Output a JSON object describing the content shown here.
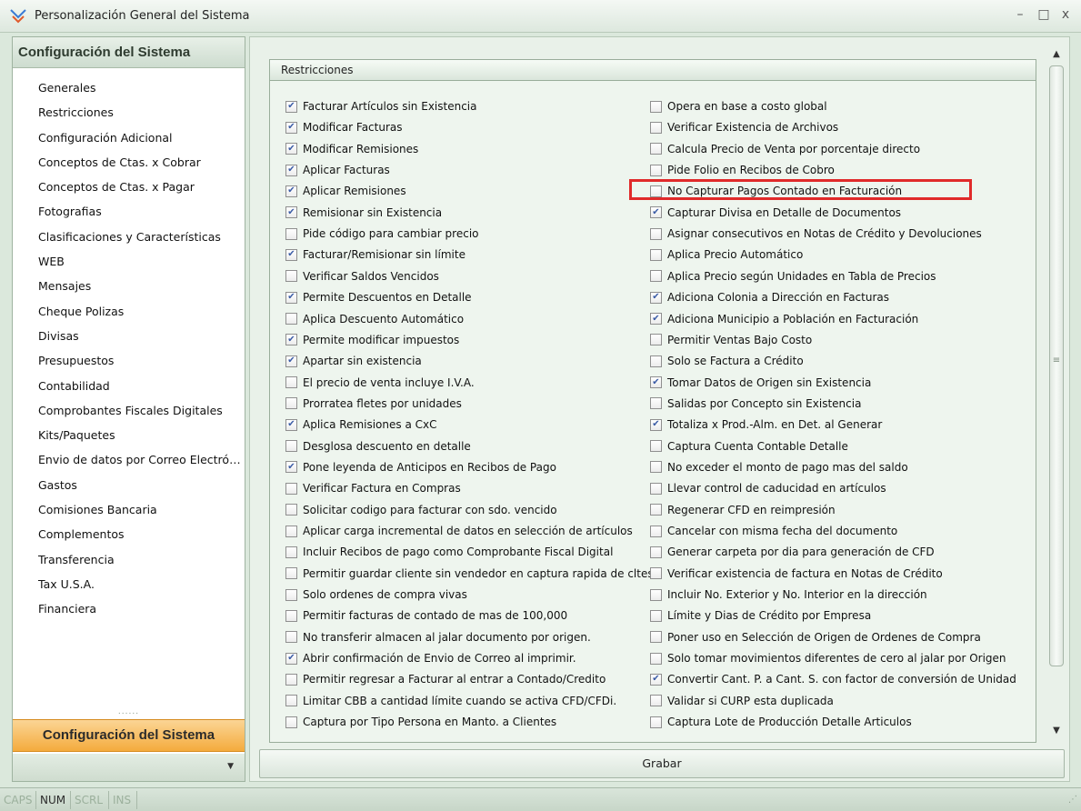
{
  "window": {
    "title": "Personalización General del Sistema",
    "minimize": "–",
    "maximize": "□",
    "close": "x"
  },
  "sidebar": {
    "header": "Configuración del Sistema",
    "items": [
      "Generales",
      "Restricciones",
      "Configuración Adicional",
      "Conceptos de Ctas. x Cobrar",
      "Conceptos de Ctas. x Pagar",
      "Fotografias",
      "Clasificaciones y Características",
      "WEB",
      "Mensajes",
      "Cheque Polizas",
      "Divisas",
      "Presupuestos",
      "Contabilidad",
      "Comprobantes Fiscales Digitales",
      "Kits/Paquetes",
      "Envio de datos por Correo Electrónico",
      "Gastos",
      "Comisiones Bancaria",
      "Complementos",
      "Transferencia",
      "Tax U.S.A.",
      "Financiera"
    ],
    "active_section": "Configuración del Sistema"
  },
  "panel": {
    "title": "Restricciones",
    "left_options": [
      {
        "label": "Facturar Artículos sin Existencia",
        "checked": true
      },
      {
        "label": "Modificar Facturas",
        "checked": true
      },
      {
        "label": "Modificar Remisiones",
        "checked": true
      },
      {
        "label": "Aplicar Facturas",
        "checked": true
      },
      {
        "label": "Aplicar Remisiones",
        "checked": true
      },
      {
        "label": "Remisionar sin Existencia",
        "checked": true
      },
      {
        "label": "Pide código para cambiar precio",
        "checked": false
      },
      {
        "label": "Facturar/Remisionar sin límite",
        "checked": true
      },
      {
        "label": "Verificar Saldos Vencidos",
        "checked": false
      },
      {
        "label": "Permite Descuentos en Detalle",
        "checked": true
      },
      {
        "label": "Aplica Descuento Automático",
        "checked": false
      },
      {
        "label": "Permite modificar impuestos",
        "checked": true
      },
      {
        "label": "Apartar sin existencia",
        "checked": true
      },
      {
        "label": "El precio de venta incluye I.V.A.",
        "checked": false
      },
      {
        "label": "Prorratea fletes por unidades",
        "checked": false
      },
      {
        "label": "Aplica Remisiones a CxC",
        "checked": true
      },
      {
        "label": "Desglosa descuento en detalle",
        "checked": false
      },
      {
        "label": "Pone leyenda de Anticipos en Recibos de Pago",
        "checked": true
      },
      {
        "label": "Verificar Factura en Compras",
        "checked": false
      },
      {
        "label": "Solicitar codigo para facturar con sdo. vencido",
        "checked": false
      },
      {
        "label": "Aplicar carga incremental de datos en selección de artículos",
        "checked": false
      },
      {
        "label": "Incluir Recibos de pago como Comprobante Fiscal Digital",
        "checked": false
      },
      {
        "label": "Permitir guardar cliente sin vendedor en captura rapida de cltes.",
        "checked": false
      },
      {
        "label": "Solo ordenes de compra vivas",
        "checked": false
      },
      {
        "label": "Permitir facturas de contado de mas de 100,000",
        "checked": false
      },
      {
        "label": "No transferir almacen al jalar documento por origen.",
        "checked": false
      },
      {
        "label": "Abrir confirmación de Envio de Correo al imprimir.",
        "checked": true
      },
      {
        "label": "Permitir regresar a Facturar al entrar a Contado/Credito",
        "checked": false
      },
      {
        "label": "Limitar CBB a cantidad límite cuando se activa CFD/CFDi.",
        "checked": false
      },
      {
        "label": "Captura por Tipo Persona en Manto. a Clientes",
        "checked": false
      }
    ],
    "right_options": [
      {
        "label": "Opera en base a costo global",
        "checked": false
      },
      {
        "label": "Verificar Existencia de Archivos",
        "checked": false
      },
      {
        "label": "Calcula Precio de Venta por porcentaje directo",
        "checked": false
      },
      {
        "label": "Pide Folio en Recibos de Cobro",
        "checked": false
      },
      {
        "label": "No Capturar Pagos Contado en Facturación",
        "checked": false
      },
      {
        "label": "Capturar Divisa en Detalle de Documentos",
        "checked": true
      },
      {
        "label": "Asignar consecutivos en Notas de Crédito y Devoluciones",
        "checked": false
      },
      {
        "label": "Aplica Precio Automático",
        "checked": false
      },
      {
        "label": "Aplica Precio según Unidades en Tabla de Precios",
        "checked": false
      },
      {
        "label": "Adiciona Colonia a Dirección en Facturas",
        "checked": true
      },
      {
        "label": "Adiciona Municipio a Población en Facturación",
        "checked": true
      },
      {
        "label": "Permitir Ventas Bajo Costo",
        "checked": false
      },
      {
        "label": "Solo se Factura a Crédito",
        "checked": false
      },
      {
        "label": "Tomar Datos de Origen sin Existencia",
        "checked": true
      },
      {
        "label": "Salidas por Concepto sin Existencia",
        "checked": false
      },
      {
        "label": "Totaliza x Prod.-Alm. en Det. al Generar",
        "checked": true
      },
      {
        "label": "Captura Cuenta Contable Detalle",
        "checked": false
      },
      {
        "label": "No exceder el monto de pago mas del saldo",
        "checked": false
      },
      {
        "label": "Llevar control de caducidad en artículos",
        "checked": false
      },
      {
        "label": "Regenerar CFD en reimpresión",
        "checked": false
      },
      {
        "label": "Cancelar con misma fecha del documento",
        "checked": false
      },
      {
        "label": "Generar carpeta por dia para generación de CFD",
        "checked": false
      },
      {
        "label": "Verificar existencia de factura en Notas de Crédito",
        "checked": false
      },
      {
        "label": "Incluir No. Exterior y No. Interior en la dirección",
        "checked": false
      },
      {
        "label": "Límite y Dias de Crédito por Empresa",
        "checked": false
      },
      {
        "label": "Poner uso en Selección de Origen de Ordenes de Compra",
        "checked": false
      },
      {
        "label": "Solo tomar movimientos diferentes de cero al jalar por Origen",
        "checked": false
      },
      {
        "label": "Convertir Cant. P. a Cant. S. con factor de conversión de Unidad",
        "checked": true
      },
      {
        "label": "Validar si CURP esta duplicada",
        "checked": false
      },
      {
        "label": "Captura Lote de Producción Detalle Articulos",
        "checked": false
      }
    ]
  },
  "save_button": "Grabar",
  "statusbar": {
    "keys": [
      {
        "label": "CAPS",
        "active": false
      },
      {
        "label": "NUM",
        "active": true
      },
      {
        "label": "SCRL",
        "active": false
      },
      {
        "label": "INS",
        "active": false
      }
    ]
  },
  "colors": {
    "active_section": "#f4ab3d",
    "highlight_border": "#e02a2a",
    "check_mark": "#3b5ca6"
  }
}
